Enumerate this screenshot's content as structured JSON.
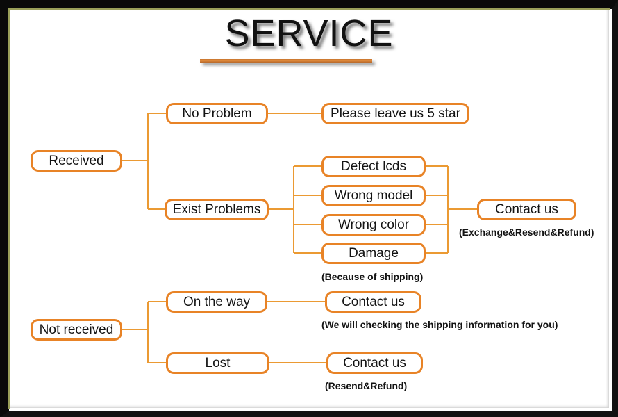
{
  "page": {
    "title": "SERVICE",
    "background_color": "#ffffff",
    "accent_color": "#e88326",
    "wire_color": "#eb9a33",
    "frame_color": "#0a0a0a",
    "frame_inner_color": "#9aa05a",
    "rule_color": "#d4802f"
  },
  "chart_data": {
    "type": "diagram",
    "title": "SERVICE",
    "orientation": "left-to-right tree",
    "roots": [
      "Received",
      "Not received"
    ],
    "nodes": [
      {
        "id": "received",
        "label": "Received",
        "level": 0
      },
      {
        "id": "no-problem",
        "label": "No Problem",
        "level": 1
      },
      {
        "id": "exist-problems",
        "label": "Exist Problems",
        "level": 1
      },
      {
        "id": "five-star",
        "label": "Please leave us 5 star",
        "level": 2
      },
      {
        "id": "defect-lcds",
        "label": "Defect lcds",
        "level": 2
      },
      {
        "id": "wrong-model",
        "label": "Wrong model",
        "level": 2
      },
      {
        "id": "wrong-color",
        "label": "Wrong color",
        "level": 2
      },
      {
        "id": "damage",
        "label": "Damage",
        "level": 2
      },
      {
        "id": "contact-us-1",
        "label": "Contact us",
        "level": 3
      },
      {
        "id": "not-received",
        "label": "Not received",
        "level": 0
      },
      {
        "id": "on-the-way",
        "label": "On the way",
        "level": 1
      },
      {
        "id": "lost",
        "label": "Lost",
        "level": 1
      },
      {
        "id": "contact-us-2",
        "label": "Contact us",
        "level": 2
      },
      {
        "id": "contact-us-3",
        "label": "Contact us",
        "level": 2
      }
    ],
    "edges": [
      {
        "from": "received",
        "to": "no-problem"
      },
      {
        "from": "received",
        "to": "exist-problems"
      },
      {
        "from": "no-problem",
        "to": "five-star"
      },
      {
        "from": "exist-problems",
        "to": "defect-lcds"
      },
      {
        "from": "exist-problems",
        "to": "wrong-model"
      },
      {
        "from": "exist-problems",
        "to": "wrong-color"
      },
      {
        "from": "exist-problems",
        "to": "damage"
      },
      {
        "from": "defect-lcds",
        "to": "contact-us-1"
      },
      {
        "from": "wrong-model",
        "to": "contact-us-1"
      },
      {
        "from": "wrong-color",
        "to": "contact-us-1"
      },
      {
        "from": "damage",
        "to": "contact-us-1"
      },
      {
        "from": "not-received",
        "to": "on-the-way"
      },
      {
        "from": "not-received",
        "to": "lost"
      },
      {
        "from": "on-the-way",
        "to": "contact-us-2"
      },
      {
        "from": "lost",
        "to": "contact-us-3"
      }
    ],
    "annotations": [
      {
        "id": "note-exchange",
        "text": "(Exchange&Resend&Refund)",
        "attached_to": "contact-us-1"
      },
      {
        "id": "note-shipping",
        "text": "(Because of shipping)",
        "attached_to": "damage"
      },
      {
        "id": "note-checking",
        "text": "(We will checking the shipping information for you)",
        "attached_to": "contact-us-2"
      },
      {
        "id": "note-resend",
        "text": "(Resend&Refund)",
        "attached_to": "contact-us-3"
      }
    ]
  },
  "nodes": {
    "received": "Received",
    "no_problem": "No Problem",
    "exist_problems": "Exist Problems",
    "five_star": "Please leave us 5 star",
    "defect_lcds": "Defect lcds",
    "wrong_model": "Wrong model",
    "wrong_color": "Wrong color",
    "damage": "Damage",
    "contact_us_problems": "Contact us",
    "not_received": "Not received",
    "on_the_way": "On the way",
    "lost": "Lost",
    "contact_us_on_the_way": "Contact us",
    "contact_us_lost": "Contact us"
  },
  "notes": {
    "exchange_resend_refund": "(Exchange&Resend&Refund)",
    "because_of_shipping": "(Because of shipping)",
    "checking_shipping_info": "(We will checking the shipping information for you)",
    "resend_refund": "(Resend&Refund)"
  }
}
